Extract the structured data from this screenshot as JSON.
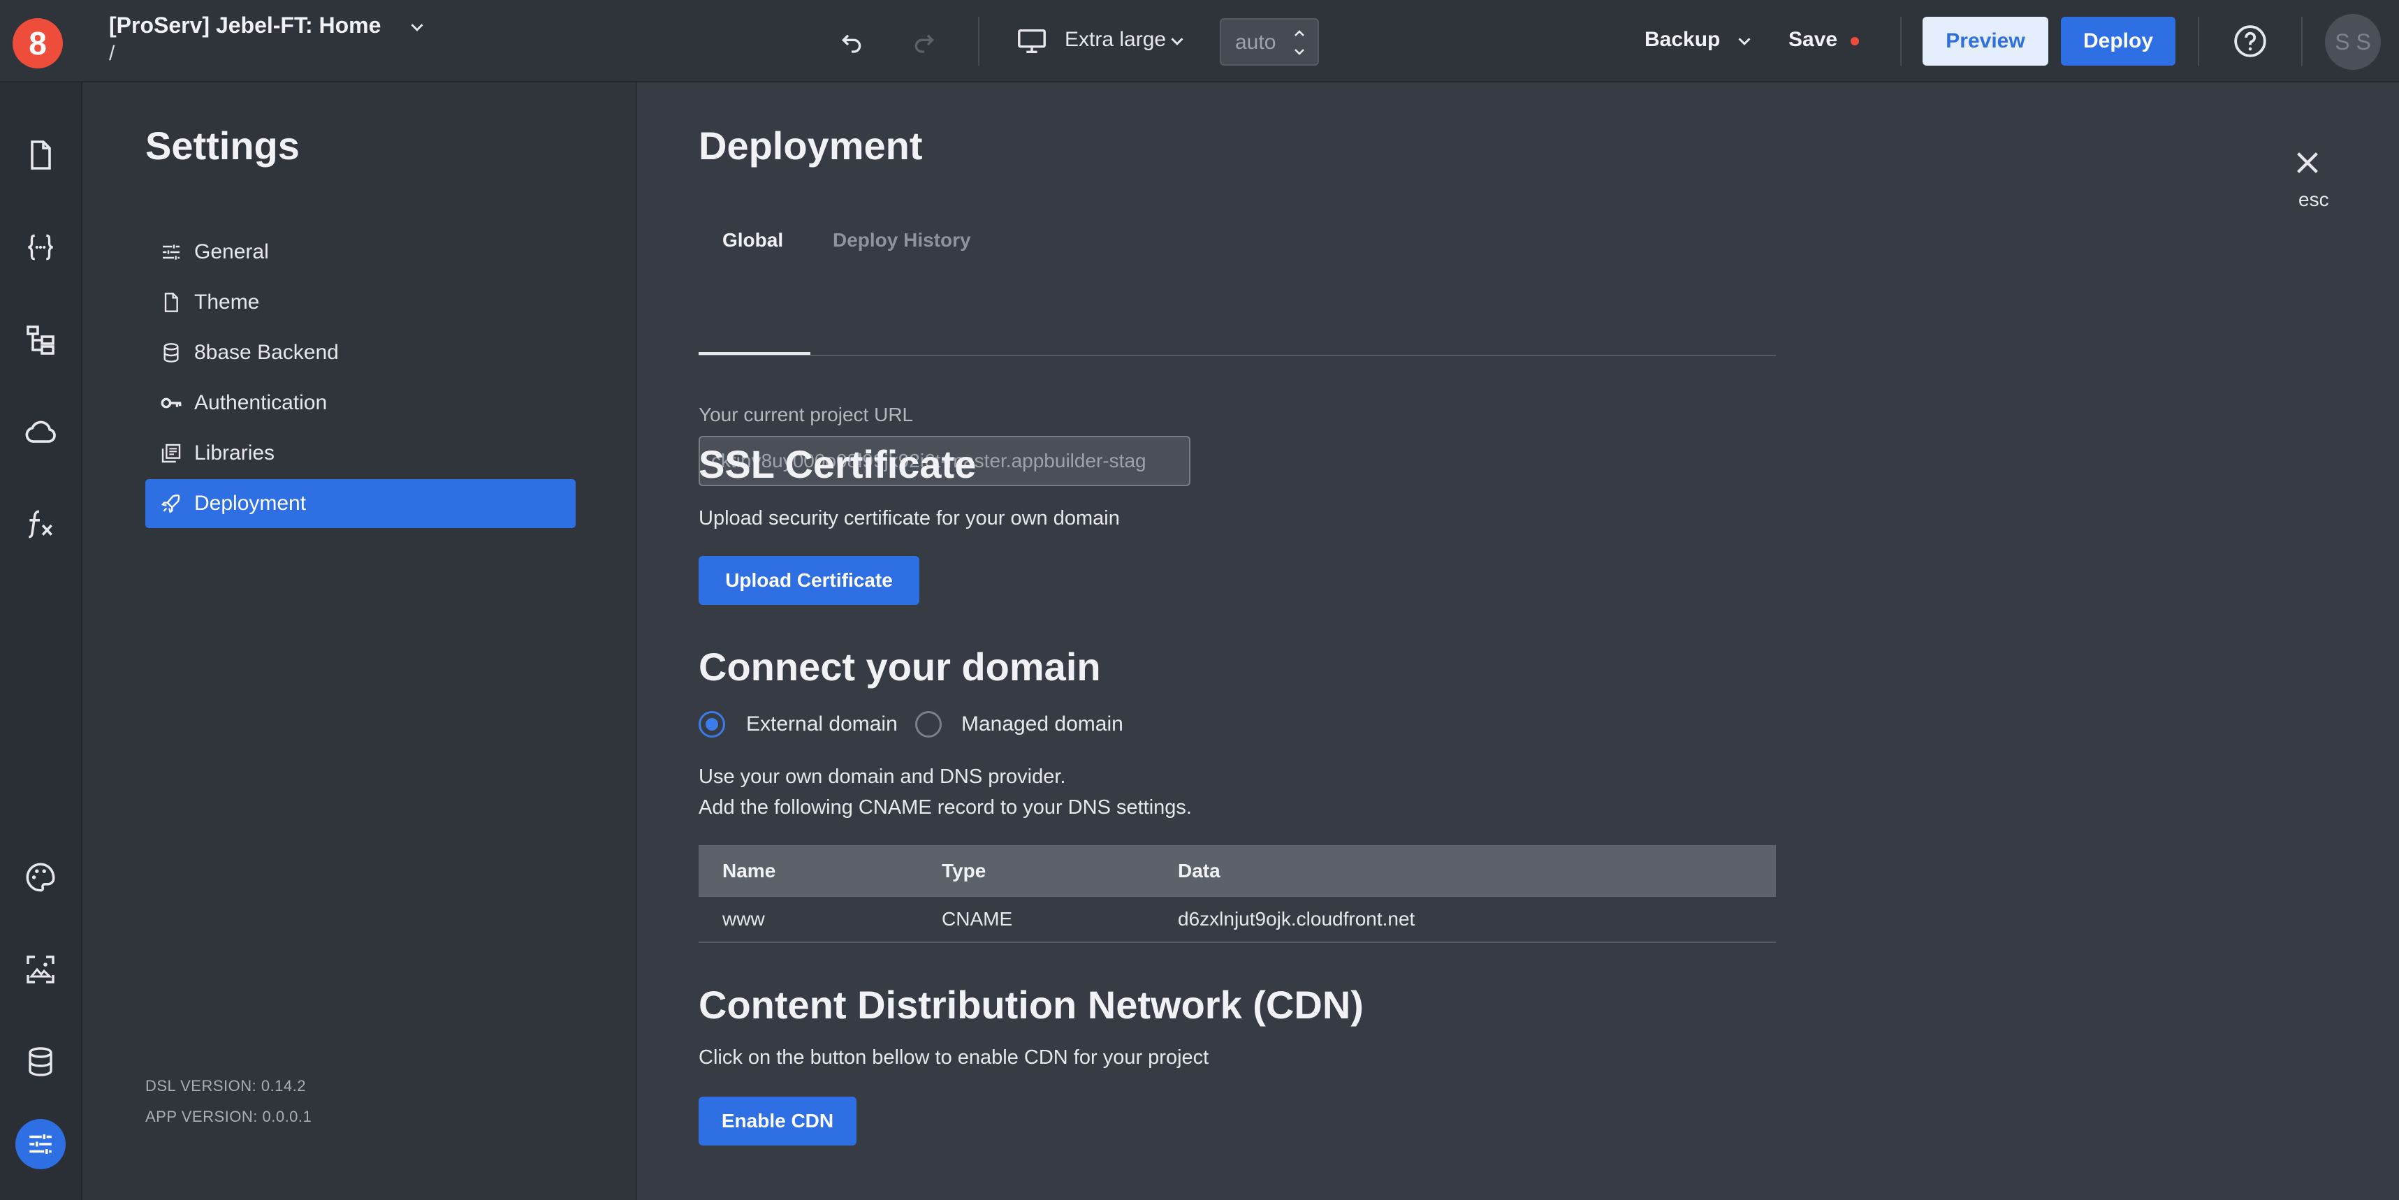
{
  "header": {
    "logo_text": "8",
    "project_title": "[ProServ] Jebel-FT: Home",
    "path": "/",
    "device_label": "Extra large",
    "zoom_value": "auto",
    "backup_label": "Backup",
    "save_label": "Save",
    "preview_label": "Preview",
    "deploy_label": "Deploy",
    "avatar_initials": "S S",
    "colors": {
      "accent": "#2f6fe4",
      "unsaved_dot": "#ef4d3c"
    }
  },
  "left_rail": {
    "top_icons": [
      "page-icon",
      "braces-icon",
      "sitemap-icon",
      "cloud-icon",
      "function-icon"
    ],
    "bottom_icons": [
      "palette-icon",
      "image-asset-icon",
      "database-icon",
      "settings-sliders-icon"
    ]
  },
  "settings": {
    "title": "Settings",
    "items": [
      {
        "label": "General",
        "icon": "sliders-icon",
        "active": false
      },
      {
        "label": "Theme",
        "icon": "file-icon",
        "active": false
      },
      {
        "label": "8base Backend",
        "icon": "database-icon",
        "active": false
      },
      {
        "label": "Authentication",
        "icon": "key-icon",
        "active": false
      },
      {
        "label": "Libraries",
        "icon": "library-icon",
        "active": false
      },
      {
        "label": "Deployment",
        "icon": "rocket-icon",
        "active": true
      }
    ],
    "dsl_version": "DSL VERSION: 0.14.2",
    "app_version": "APP VERSION: 0.0.0.1"
  },
  "main": {
    "title": "Deployment",
    "esc_label": "esc",
    "tabs": [
      {
        "label": "Global",
        "active": true
      },
      {
        "label": "Deploy History",
        "active": false
      }
    ],
    "project_url_label": "Your current project URL",
    "project_url_value": "cktinv8uy000o08l99jk92i6t-master.appbuilder-stag",
    "ssl": {
      "title": "SSL Certificate",
      "description": "Upload security certificate for your own domain",
      "button_label": "Upload Certificate"
    },
    "domain": {
      "title": "Connect your domain",
      "options": [
        {
          "label": "External domain",
          "checked": true
        },
        {
          "label": "Managed domain",
          "checked": false
        }
      ],
      "line1": "Use your own domain and DNS provider.",
      "line2": "Add the following CNAME record to your DNS settings.",
      "table": {
        "columns": [
          "Name",
          "Type",
          "Data"
        ],
        "rows": [
          [
            "www",
            "CNAME",
            "d6zxlnjut9ojk.cloudfront.net"
          ]
        ]
      }
    },
    "cdn": {
      "title": "Content Distribution Network (CDN)",
      "description": "Click on the button bellow to enable CDN for your project",
      "button_label": "Enable CDN"
    }
  }
}
